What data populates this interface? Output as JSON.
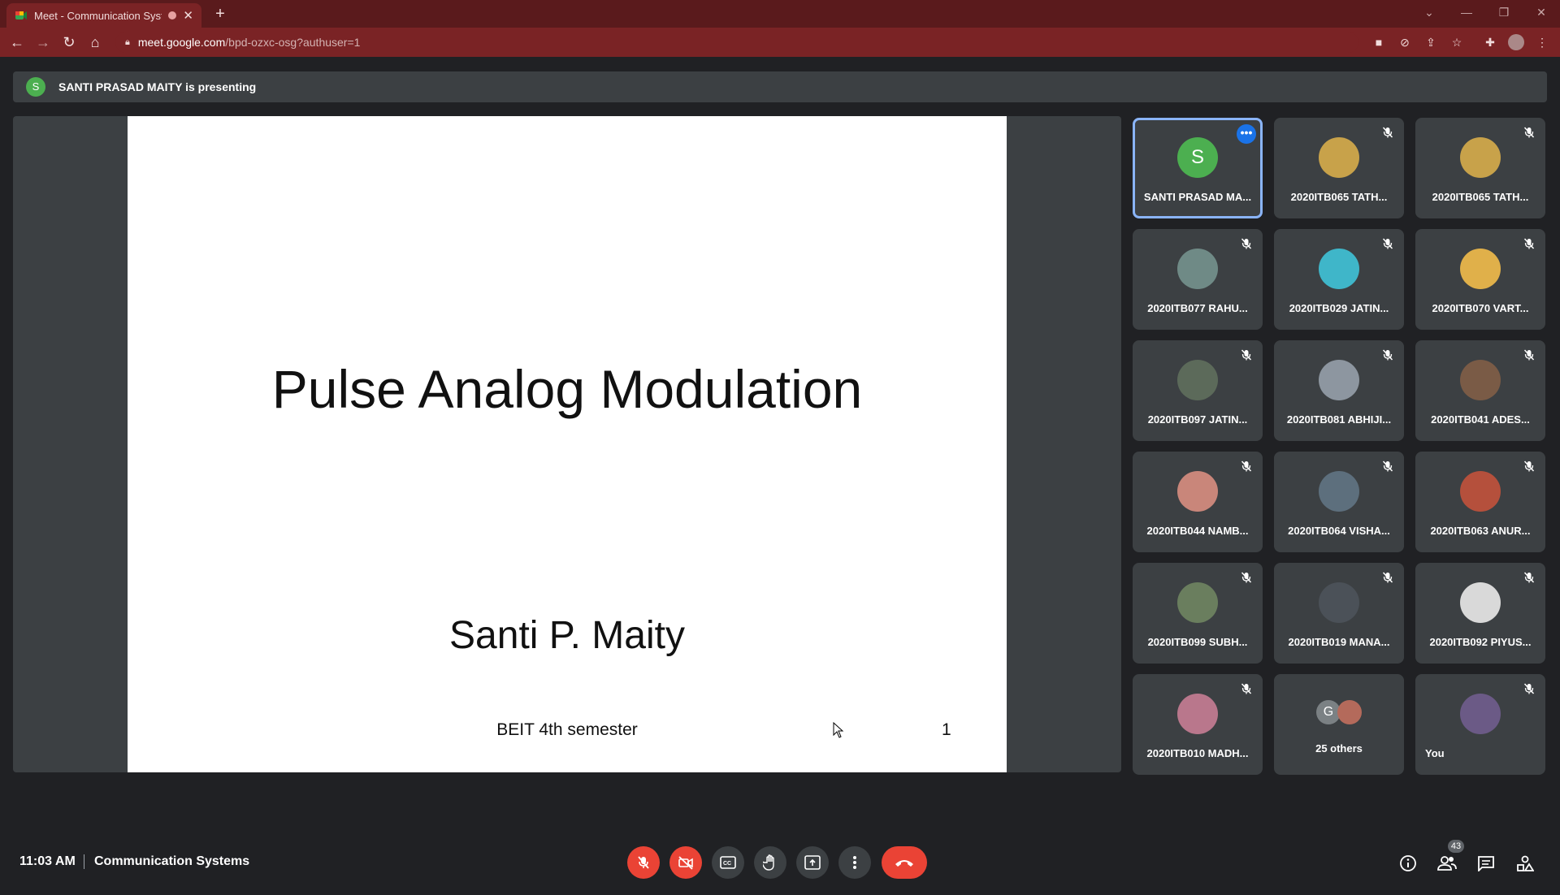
{
  "browser": {
    "tab_title": "Meet - Communication Syste",
    "url_host": "meet.google.com",
    "url_path": "/bpd-ozxc-osg?authuser=1"
  },
  "meet": {
    "presenter_initial": "S",
    "presenting_text": "SANTI PRASAD MAITY is presenting",
    "slide": {
      "title": "Pulse Analog Modulation",
      "author": "Santi P. Maity",
      "course": "BEIT 4th semester",
      "page": "1"
    },
    "participants": [
      {
        "name": "SANTI PRASAD MA...",
        "initial": "S",
        "color": "#4caf50",
        "active": true
      },
      {
        "name": "2020ITB065 TATH...",
        "color": "#c8a24a"
      },
      {
        "name": "2020ITB065 TATH...",
        "color": "#c8a24a"
      },
      {
        "name": "2020ITB077 RAHU...",
        "color": "#6f8a86"
      },
      {
        "name": "2020ITB029 JATIN...",
        "color": "#3fb6c9"
      },
      {
        "name": "2020ITB070 VART...",
        "color": "#e0b04a"
      },
      {
        "name": "2020ITB097 JATIN...",
        "color": "#5c6a5a"
      },
      {
        "name": "2020ITB081 ABHIJI...",
        "color": "#8d96a0"
      },
      {
        "name": "2020ITB041 ADES...",
        "color": "#7a5b46"
      },
      {
        "name": "2020ITB044 NAMB...",
        "color": "#c9867a"
      },
      {
        "name": "2020ITB064 VISHA...",
        "color": "#5d6f7d"
      },
      {
        "name": "2020ITB063 ANUR...",
        "color": "#b5503c"
      },
      {
        "name": "2020ITB099 SUBH...",
        "color": "#6a7e5e"
      },
      {
        "name": "2020ITB019 MANA...",
        "color": "#4b5158"
      },
      {
        "name": "2020ITB092 PIYUS...",
        "color": "#d9d9d9"
      },
      {
        "name": "2020ITB010 MADH...",
        "color": "#b9778c"
      }
    ],
    "others": {
      "initial": "G",
      "label": "25 others"
    },
    "self": {
      "name": "You",
      "color": "#6b5a86"
    },
    "time": "11:03 AM",
    "meeting_name": "Communication Systems",
    "people_count": "43"
  }
}
